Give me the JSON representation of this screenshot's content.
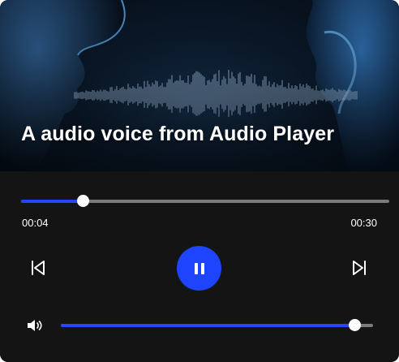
{
  "player": {
    "title": "A audio voice from Audio Player",
    "current_time": "00:04",
    "total_time": "00:30",
    "progress": 0.1667,
    "volume": 0.94,
    "state": "playing"
  },
  "icons": {
    "previous": "skip-previous-icon",
    "pause": "pause-icon",
    "next": "skip-next-icon",
    "volume": "volume-icon"
  },
  "colors": {
    "accent": "#1e44ff",
    "background": "#141414",
    "track": "#7b7b7b",
    "text": "#ffffff"
  }
}
